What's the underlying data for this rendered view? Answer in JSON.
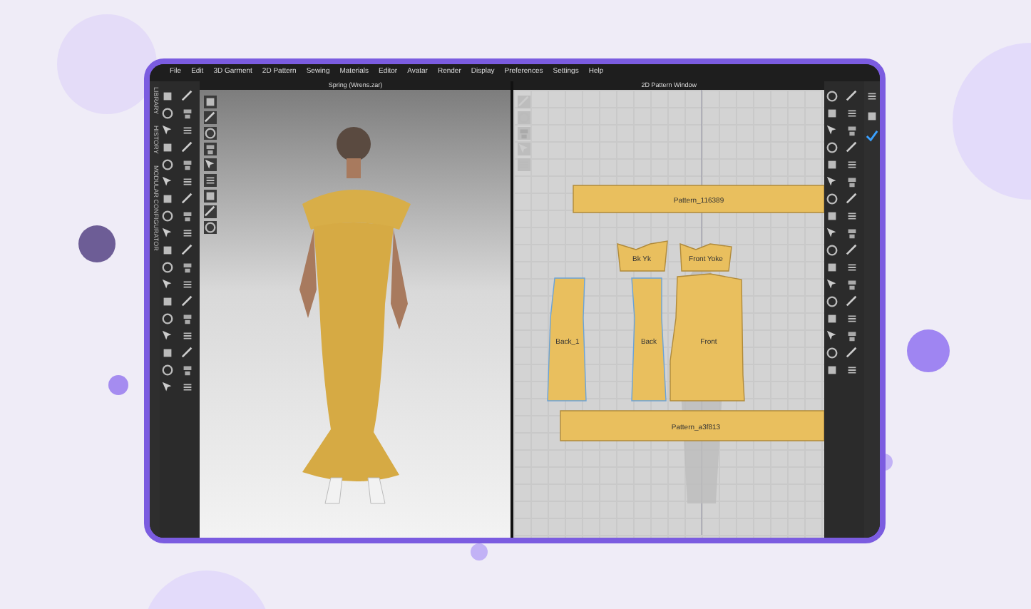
{
  "menu": [
    "File",
    "Edit",
    "3D Garment",
    "2D Pattern",
    "Sewing",
    "Materials",
    "Editor",
    "Avatar",
    "Render",
    "Display",
    "Preferences",
    "Settings",
    "Help"
  ],
  "side_tabs": [
    "LIBRARY",
    "HISTORY",
    "MODULAR CONFIGURATOR"
  ],
  "view_3d": {
    "title": "Spring (Wrens.zar)"
  },
  "pattern_window": {
    "title": "2D Pattern Window",
    "pieces": [
      {
        "label": "Pattern_116389"
      },
      {
        "label": "Bk Yk"
      },
      {
        "label": "Front Yoke"
      },
      {
        "label": "Back_1"
      },
      {
        "label": "Back"
      },
      {
        "label": "Front"
      },
      {
        "label": "Pattern_a3f813"
      }
    ]
  }
}
